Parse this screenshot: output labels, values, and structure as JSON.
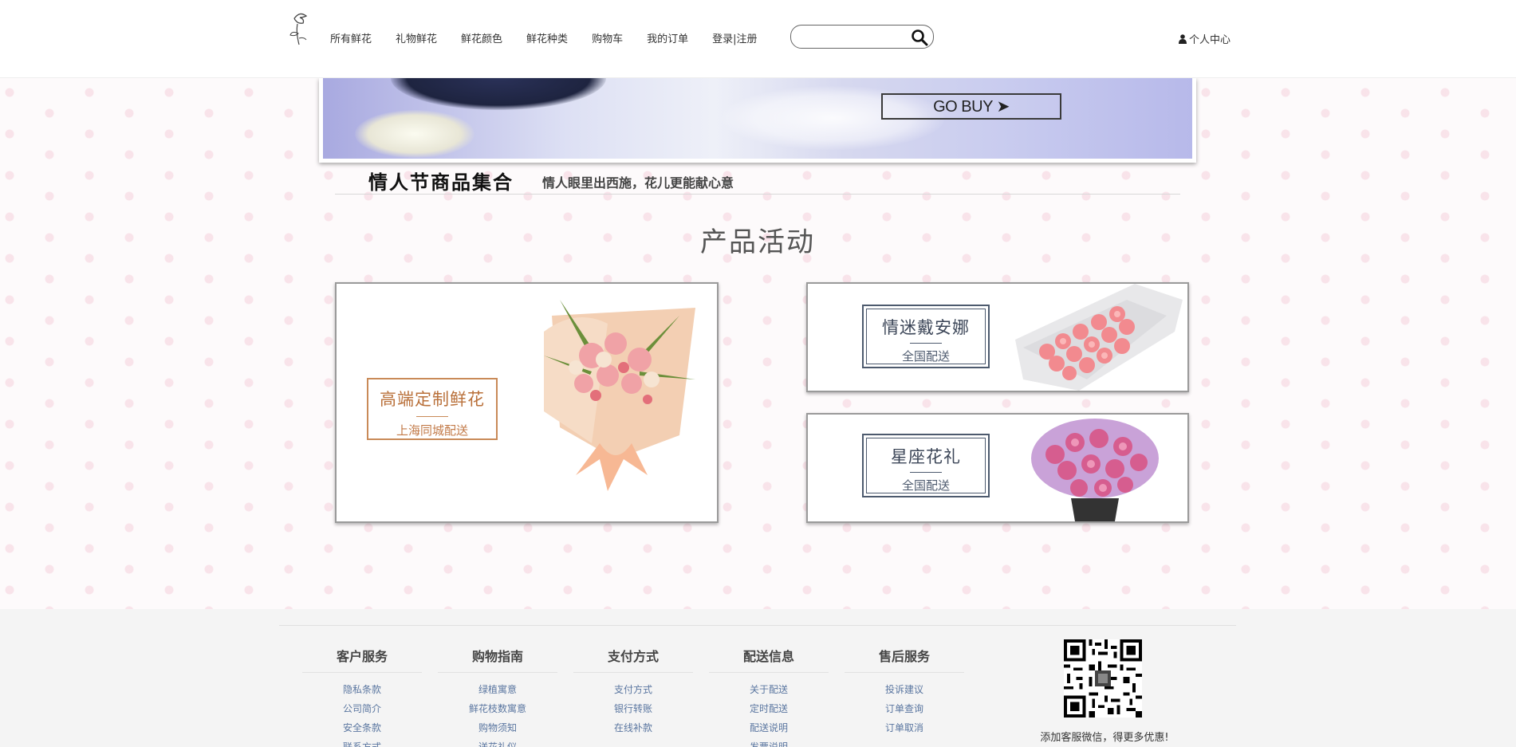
{
  "header": {
    "nav": [
      {
        "label": "所有鲜花"
      },
      {
        "label": "礼物鲜花"
      },
      {
        "label": "鲜花颜色"
      },
      {
        "label": "鲜花种类"
      },
      {
        "label": "购物车"
      },
      {
        "label": "我的订单"
      },
      {
        "label": "登录|注册"
      }
    ],
    "search": {
      "placeholder": "",
      "value": ""
    },
    "user_center": "个人中心"
  },
  "banner": {
    "button_label": "GO BUY ➤"
  },
  "strip": {
    "title": "情人节商品集合",
    "subtitle": "情人眼里出西施，花儿更能献心意"
  },
  "section": {
    "title": "产品活动"
  },
  "promos": [
    {
      "title": "高端定制鲜花",
      "subtitle": "上海同城配送"
    },
    {
      "title": "情迷戴安娜",
      "subtitle": "全国配送"
    },
    {
      "title": "星座花礼",
      "subtitle": "全国配送"
    }
  ],
  "footer": {
    "columns": [
      {
        "title": "客户服务",
        "links": [
          "隐私条款",
          "公司简介",
          "安全条款",
          "联系方式"
        ]
      },
      {
        "title": "购物指南",
        "links": [
          "绿植寓意",
          "鲜花枝数寓意",
          "购物须知",
          "送花礼仪"
        ]
      },
      {
        "title": "支付方式",
        "links": [
          "支付方式",
          "银行转账",
          "在线补款"
        ]
      },
      {
        "title": "配送信息",
        "links": [
          "关于配送",
          "定时配送",
          "配送说明",
          "发票说明"
        ]
      },
      {
        "title": "售后服务",
        "links": [
          "投诉建议",
          "订单查询",
          "订单取消"
        ]
      }
    ],
    "qr_caption": "添加客服微信，得更多优惠!"
  },
  "colors": {
    "accent_gold": "#c98a58",
    "accent_slate": "#4d5a6e",
    "link_blue": "#5a76a0",
    "footer_bg": "#f4f4f4"
  }
}
